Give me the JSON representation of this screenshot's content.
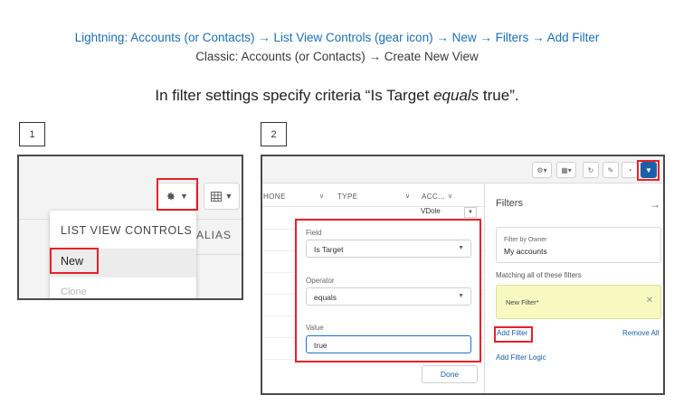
{
  "nav": {
    "lightning": "Lightning: Accounts (or Contacts) → List View Controls (gear icon) → New → Filters → Add Filter",
    "classic": "Classic: Accounts (or Contacts) → Create New View"
  },
  "instruction": {
    "before": "In filter settings specify criteria “Is Target ",
    "emphasis": "equals",
    "after": " true”."
  },
  "steps": [
    "1",
    "2"
  ],
  "panel1": {
    "menu_title": "LIST VIEW CONTROLS",
    "new_item": "New",
    "clone_item": "Clone",
    "column_alias": "ALIAS",
    "gear_icon": "gear-icon",
    "table_icon": "table-icon"
  },
  "panel2": {
    "columns": [
      "HONE",
      "TYPE",
      "ACC..."
    ],
    "row_value": "VDole",
    "popover": {
      "field_label": "Field",
      "field_value": "Is Target",
      "operator_label": "Operator",
      "operator_value": "equals",
      "value_label": "Value",
      "value_value": "true",
      "done_label": "Done"
    },
    "filters_panel": {
      "title": "Filters",
      "owner_label": "Filter by Owner",
      "owner_value": "My accounts",
      "matching_label": "Matching all of these filters",
      "new_filter_label": "New Filter*",
      "add_filter": "Add Filter",
      "remove_all": "Remove All",
      "add_filter_logic": "Add Filter Logic"
    },
    "toolbar_icons": [
      "gear-icon",
      "table-icon",
      "refresh-icon",
      "edit-icon",
      "chart-icon",
      "filter-icon"
    ],
    "accent_color": "#1b5fa8",
    "highlight_color": "#e8202a"
  }
}
